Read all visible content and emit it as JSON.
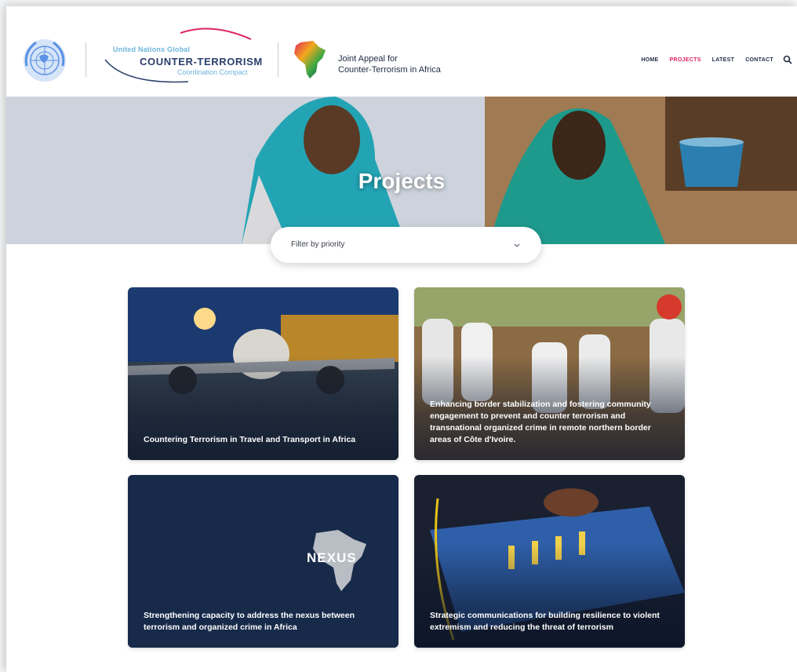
{
  "header": {
    "un_logo_icon": "un-emblem-icon",
    "compact_logo": {
      "line1": "United Nations Global",
      "line2": "COUNTER-TERRORISM",
      "line3": "Coordination Compact"
    },
    "joint_appeal": {
      "line1": "Joint Appeal for",
      "line2": "Counter-Terrorism in Africa"
    },
    "nav": [
      {
        "label": "HOME",
        "active": false
      },
      {
        "label": "PROJECTS",
        "active": true
      },
      {
        "label": "LATEST",
        "active": false
      },
      {
        "label": "CONTACT",
        "active": false
      }
    ],
    "search_icon": "search-icon"
  },
  "hero": {
    "title": "Projects"
  },
  "filter": {
    "placeholder": "Filter by priority"
  },
  "cards": [
    {
      "title": "Countering Terrorism in Travel and Transport in Africa"
    },
    {
      "title": "Enhancing border stabilization and fostering community engagement to prevent and counter terrorism and transnational organized crime in remote northern border areas of Côte d'Ivoire."
    },
    {
      "title": "Strengthening capacity to address the nexus between terrorism and organized crime in Africa",
      "image_text": "NEXUS"
    },
    {
      "title": "Strategic communications for building resilience to violent extremism and reducing the threat of terrorism"
    }
  ],
  "colors": {
    "accent": "#e0245e",
    "navy": "#1f2a44",
    "card_nexus_bg": "#172a4a"
  }
}
